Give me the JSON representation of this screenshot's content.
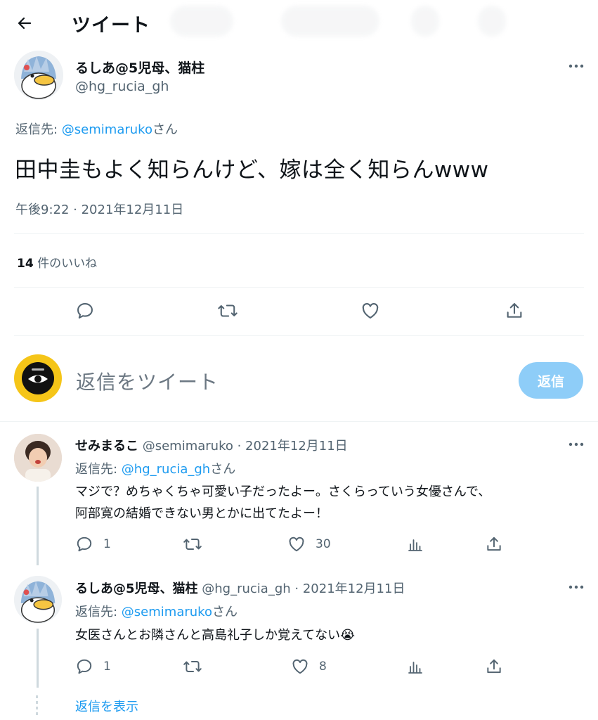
{
  "header": {
    "title": "ツイート"
  },
  "tweet": {
    "author_name": "るしあ@5児母、猫柱",
    "author_handle": "@hg_rucia_gh",
    "reply_to_label": "返信先: ",
    "reply_to_handle": "@semimaruko",
    "reply_to_suffix": "さん",
    "text": "田中圭もよく知らんけど、嫁は全く知らんwww",
    "timestamp": "午後9:22 · 2021年12月11日",
    "likes_count": "14",
    "likes_label": " 件のいいね"
  },
  "composer": {
    "placeholder": "返信をツイート",
    "button_label": "返信"
  },
  "replies": [
    {
      "name": "せみまるこ",
      "handle": "@semimaruko",
      "date": " · 2021年12月11日",
      "reply_to_label": "返信先: ",
      "reply_to_handle": "@hg_rucia_gh",
      "reply_to_suffix": "さん",
      "text_line1": "マジで？めちゃくちゃ可愛い子だったよー。さくらっていう女優さんで、",
      "text_line2": "阿部寛の結婚できない男とかに出てたよー！",
      "reply_count": "1",
      "like_count": "30"
    },
    {
      "name": "るしあ@5児母、猫柱",
      "handle": "@hg_rucia_gh",
      "date": " · 2021年12月11日",
      "reply_to_label": "返信先: ",
      "reply_to_handle": "@semimaruko",
      "reply_to_suffix": "さん",
      "text_line1": "女医さんとお隣さんと高島礼子しか覚えてない",
      "emoji": "😭",
      "reply_count": "1",
      "like_count": "8"
    }
  ],
  "show_replies": "返信を表示",
  "icons": [
    "back-arrow-icon",
    "more-icon",
    "reply-icon",
    "retweet-icon",
    "like-icon",
    "share-icon",
    "analytics-icon"
  ],
  "colors": {
    "accent": "#1d9bf0",
    "reply_button": "#8ecdf8",
    "composer_avatar": "#f5c518",
    "muted": "#536471"
  }
}
